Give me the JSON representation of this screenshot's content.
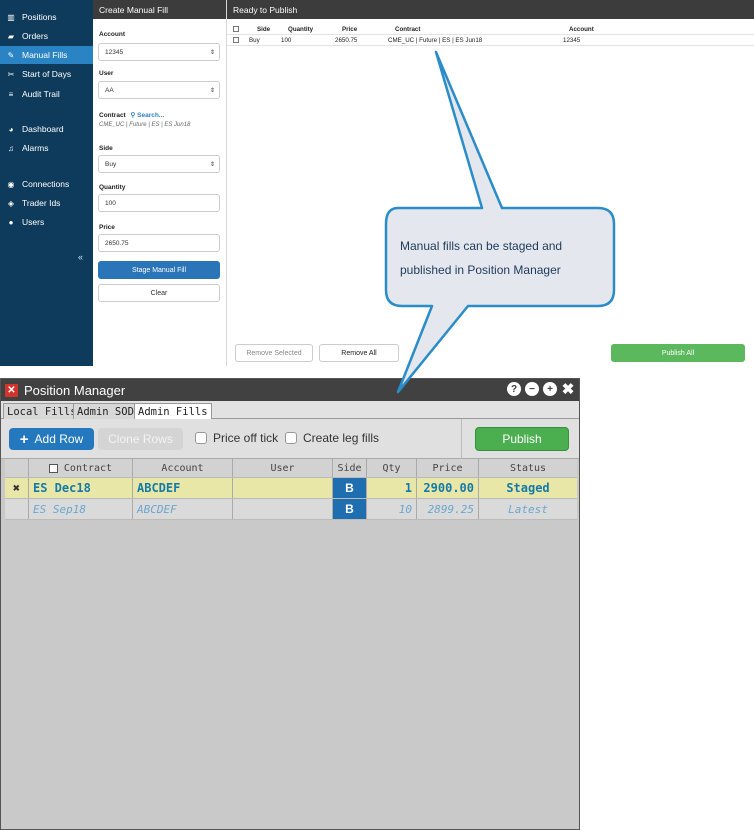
{
  "nav": {
    "items": [
      {
        "label": "Positions",
        "icon": "chart-icon"
      },
      {
        "label": "Orders",
        "icon": "book-icon"
      },
      {
        "label": "Manual Fills",
        "icon": "wrench-icon"
      },
      {
        "label": "Start of Days",
        "icon": "tag-icon"
      },
      {
        "label": "Audit Trail",
        "icon": "list-icon"
      },
      {
        "label": "Dashboard",
        "icon": "dashboard-icon"
      },
      {
        "label": "Alarms",
        "icon": "bell-icon"
      },
      {
        "label": "Connections",
        "icon": "globe-icon"
      },
      {
        "label": "Trader Ids",
        "icon": "tag-icon"
      },
      {
        "label": "Users",
        "icon": "user-icon"
      }
    ],
    "active": "Manual Fills",
    "collapse": "«"
  },
  "form": {
    "title": "Create Manual Fill",
    "account_label": "Account",
    "account_value": "12345",
    "user_label": "User",
    "user_value": "AA",
    "contract_label": "Contract",
    "search_label": "Search...",
    "contract_value": "CME_UC | Future | ES | ES Jun18",
    "side_label": "Side",
    "side_value": "Buy",
    "quantity_label": "Quantity",
    "quantity_value": "100",
    "price_label": "Price",
    "price_value": "2650.75",
    "stage_button": "Stage Manual Fill",
    "clear_button": "Clear"
  },
  "publish_panel": {
    "title": "Ready to Publish",
    "columns": [
      "Side",
      "Quantity",
      "Price",
      "Contract",
      "Account"
    ],
    "rows": [
      {
        "side": "Buy",
        "quantity": "100",
        "price": "2650.75",
        "contract": "CME_UC | Future | ES | ES Jun18",
        "account": "12345"
      }
    ],
    "remove_selected": "Remove Selected",
    "remove_all": "Remove All",
    "publish_all": "Publish All"
  },
  "callout": {
    "line1": "Manual fills can be staged and",
    "line2": "published in Position Manager"
  },
  "position_manager": {
    "title": "Position Manager",
    "tabs": [
      "Local Fills",
      "Admin SOD",
      "Admin Fills"
    ],
    "active_tab": "Admin Fills",
    "add_row": "Add Row",
    "clone_rows": "Clone Rows",
    "price_off_tick": "Price off tick",
    "create_leg_fills": "Create leg fills",
    "publish": "Publish",
    "columns": [
      "Contract",
      "Account",
      "User",
      "Side",
      "Qty",
      "Price",
      "Status"
    ],
    "rows": [
      {
        "mark": "✖",
        "contract": "ES Dec18",
        "account": "ABCDEF",
        "user": "",
        "side": "B",
        "qty": "1",
        "price": "2900.00",
        "status": "Staged"
      },
      {
        "mark": "",
        "contract": "ES Sep18",
        "account": "ABCDEF",
        "user": "",
        "side": "B",
        "qty": "10",
        "price": "2899.25",
        "status": "Latest"
      }
    ],
    "colors": {
      "staged_bg": "#e8e7a8",
      "side_bg": "#1f6fb0",
      "publish_bg": "#4bae4f",
      "add_row_bg": "#2479be"
    }
  }
}
